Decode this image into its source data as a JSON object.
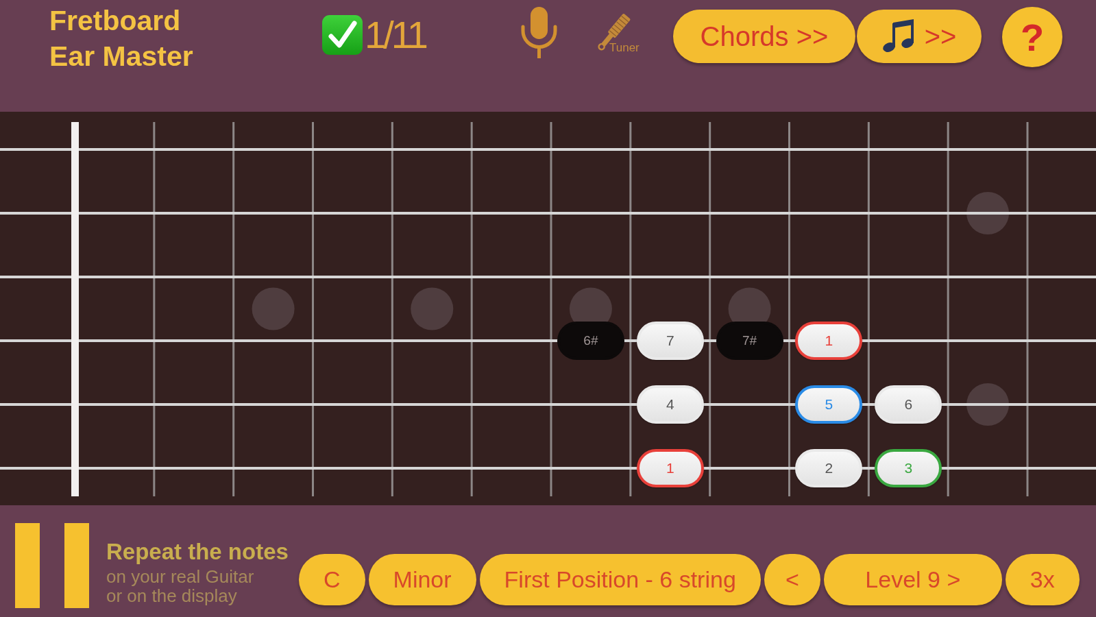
{
  "header": {
    "title_lines": [
      "Fretboard",
      "Ear Master"
    ],
    "score": "1/11",
    "tools": [
      {
        "kind": "microphone"
      },
      {
        "kind": "tuner",
        "label": "Tuner"
      }
    ],
    "buttons": [
      {
        "kind": "chords",
        "label": "Chords >>"
      },
      {
        "kind": "notes",
        "label": ">>"
      },
      {
        "kind": "help",
        "label": "?"
      }
    ]
  },
  "fretboard": {
    "strings": [
      {
        "frets": [
          {
            "kind": "blank"
          },
          {
            "kind": "blank"
          },
          {
            "kind": "blank"
          },
          {
            "kind": "blank"
          },
          {
            "kind": "blank"
          },
          {
            "kind": "blank"
          },
          {
            "kind": "blank"
          },
          {
            "kind": "blank"
          },
          {
            "kind": "blank"
          },
          {
            "kind": "blank"
          },
          {
            "kind": "blank"
          },
          {
            "kind": "blank"
          }
        ]
      },
      {
        "frets": [
          {
            "kind": "blank"
          },
          {
            "kind": "blank"
          },
          {
            "kind": "blank"
          },
          {
            "kind": "blank"
          },
          {
            "kind": "blank"
          },
          {
            "kind": "blank"
          },
          {
            "kind": "blank"
          },
          {
            "kind": "blank"
          },
          {
            "kind": "blank"
          },
          {
            "kind": "blank"
          },
          {
            "kind": "blank"
          },
          {
            "kind": "blank"
          }
        ]
      },
      {
        "frets": [
          {
            "kind": "blank"
          },
          {
            "kind": "blank"
          },
          {
            "kind": "blank"
          },
          {
            "kind": "blank"
          },
          {
            "kind": "blank"
          },
          {
            "kind": "blank"
          },
          {
            "kind": "blank"
          },
          {
            "kind": "blank"
          },
          {
            "kind": "blank"
          },
          {
            "kind": "blank"
          },
          {
            "kind": "blank"
          },
          {
            "kind": "blank"
          }
        ]
      },
      {
        "frets": [
          {
            "kind": "blank"
          },
          {
            "kind": "blank"
          },
          {
            "kind": "blank"
          },
          {
            "kind": "blank"
          },
          {
            "kind": "blank"
          },
          {
            "kind": "blank"
          },
          {
            "label": "6#",
            "kind": "chromatic"
          },
          {
            "label": "7",
            "kind": "scale"
          },
          {
            "label": "7#",
            "kind": "chromatic"
          },
          {
            "label": "1",
            "kind": "scale",
            "color": "#e8403a"
          },
          {
            "kind": "blank"
          },
          {
            "kind": "blank"
          }
        ]
      },
      {
        "frets": [
          {
            "kind": "blank"
          },
          {
            "kind": "blank"
          },
          {
            "kind": "blank"
          },
          {
            "kind": "blank"
          },
          {
            "kind": "blank"
          },
          {
            "kind": "blank"
          },
          {
            "kind": "blank"
          },
          {
            "label": "4",
            "kind": "scale"
          },
          {
            "kind": "blank"
          },
          {
            "label": "5",
            "kind": "scale",
            "color": "#2a8be6"
          },
          {
            "label": "6",
            "kind": "scale"
          },
          {
            "kind": "blank"
          }
        ]
      },
      {
        "frets": [
          {
            "kind": "blank"
          },
          {
            "kind": "blank"
          },
          {
            "kind": "blank"
          },
          {
            "kind": "blank"
          },
          {
            "kind": "blank"
          },
          {
            "kind": "blank"
          },
          {
            "kind": "blank"
          },
          {
            "label": "1",
            "kind": "scale",
            "color": "#e8403a"
          },
          {
            "kind": "blank"
          },
          {
            "label": "2",
            "kind": "scale"
          },
          {
            "label": "3",
            "kind": "scale",
            "color": "#3aa840"
          },
          {
            "kind": "blank"
          }
        ]
      }
    ]
  },
  "footer": {
    "playback": {
      "playing": true
    },
    "instruction": {
      "heading": "Repeat the notes",
      "detail_lines": [
        "on your real Guitar",
        "or on the display"
      ]
    },
    "options": [
      {
        "kind": "option",
        "label": "C"
      },
      {
        "kind": "option",
        "label": "Minor"
      },
      {
        "kind": "option",
        "label": "First Position - 6 string"
      },
      {
        "kind": "previous",
        "label": "<"
      },
      {
        "kind": "level",
        "label": "Level 9 >"
      },
      {
        "kind": "option",
        "label": "3x"
      }
    ]
  }
}
